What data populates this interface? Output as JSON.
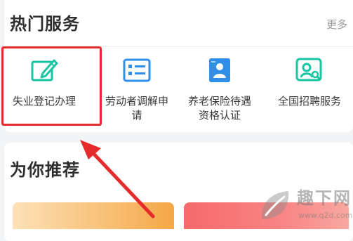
{
  "hot_services": {
    "title": "热门服务",
    "more_label": "更多",
    "items": [
      {
        "label": "失业登记办理",
        "icon": "edit-form-icon"
      },
      {
        "label": "劳动者调解申\n请",
        "icon": "list-form-icon"
      },
      {
        "label": "养老保险待遇\n资格认证",
        "icon": "id-badge-icon"
      },
      {
        "label": "全国招聘服务",
        "icon": "search-person-icon"
      }
    ]
  },
  "recommend": {
    "title": "为你推荐"
  },
  "watermark": {
    "text": "趣下网",
    "url": "www.q2d.com"
  },
  "colors": {
    "icon_green": "#18c5a2",
    "icon_blue": "#2f8ee8",
    "highlight_red": "#e52b2b",
    "arrow_red": "#e52b2b",
    "tile_orange": "#f8c27a",
    "tile_red": "#f66a6a"
  }
}
